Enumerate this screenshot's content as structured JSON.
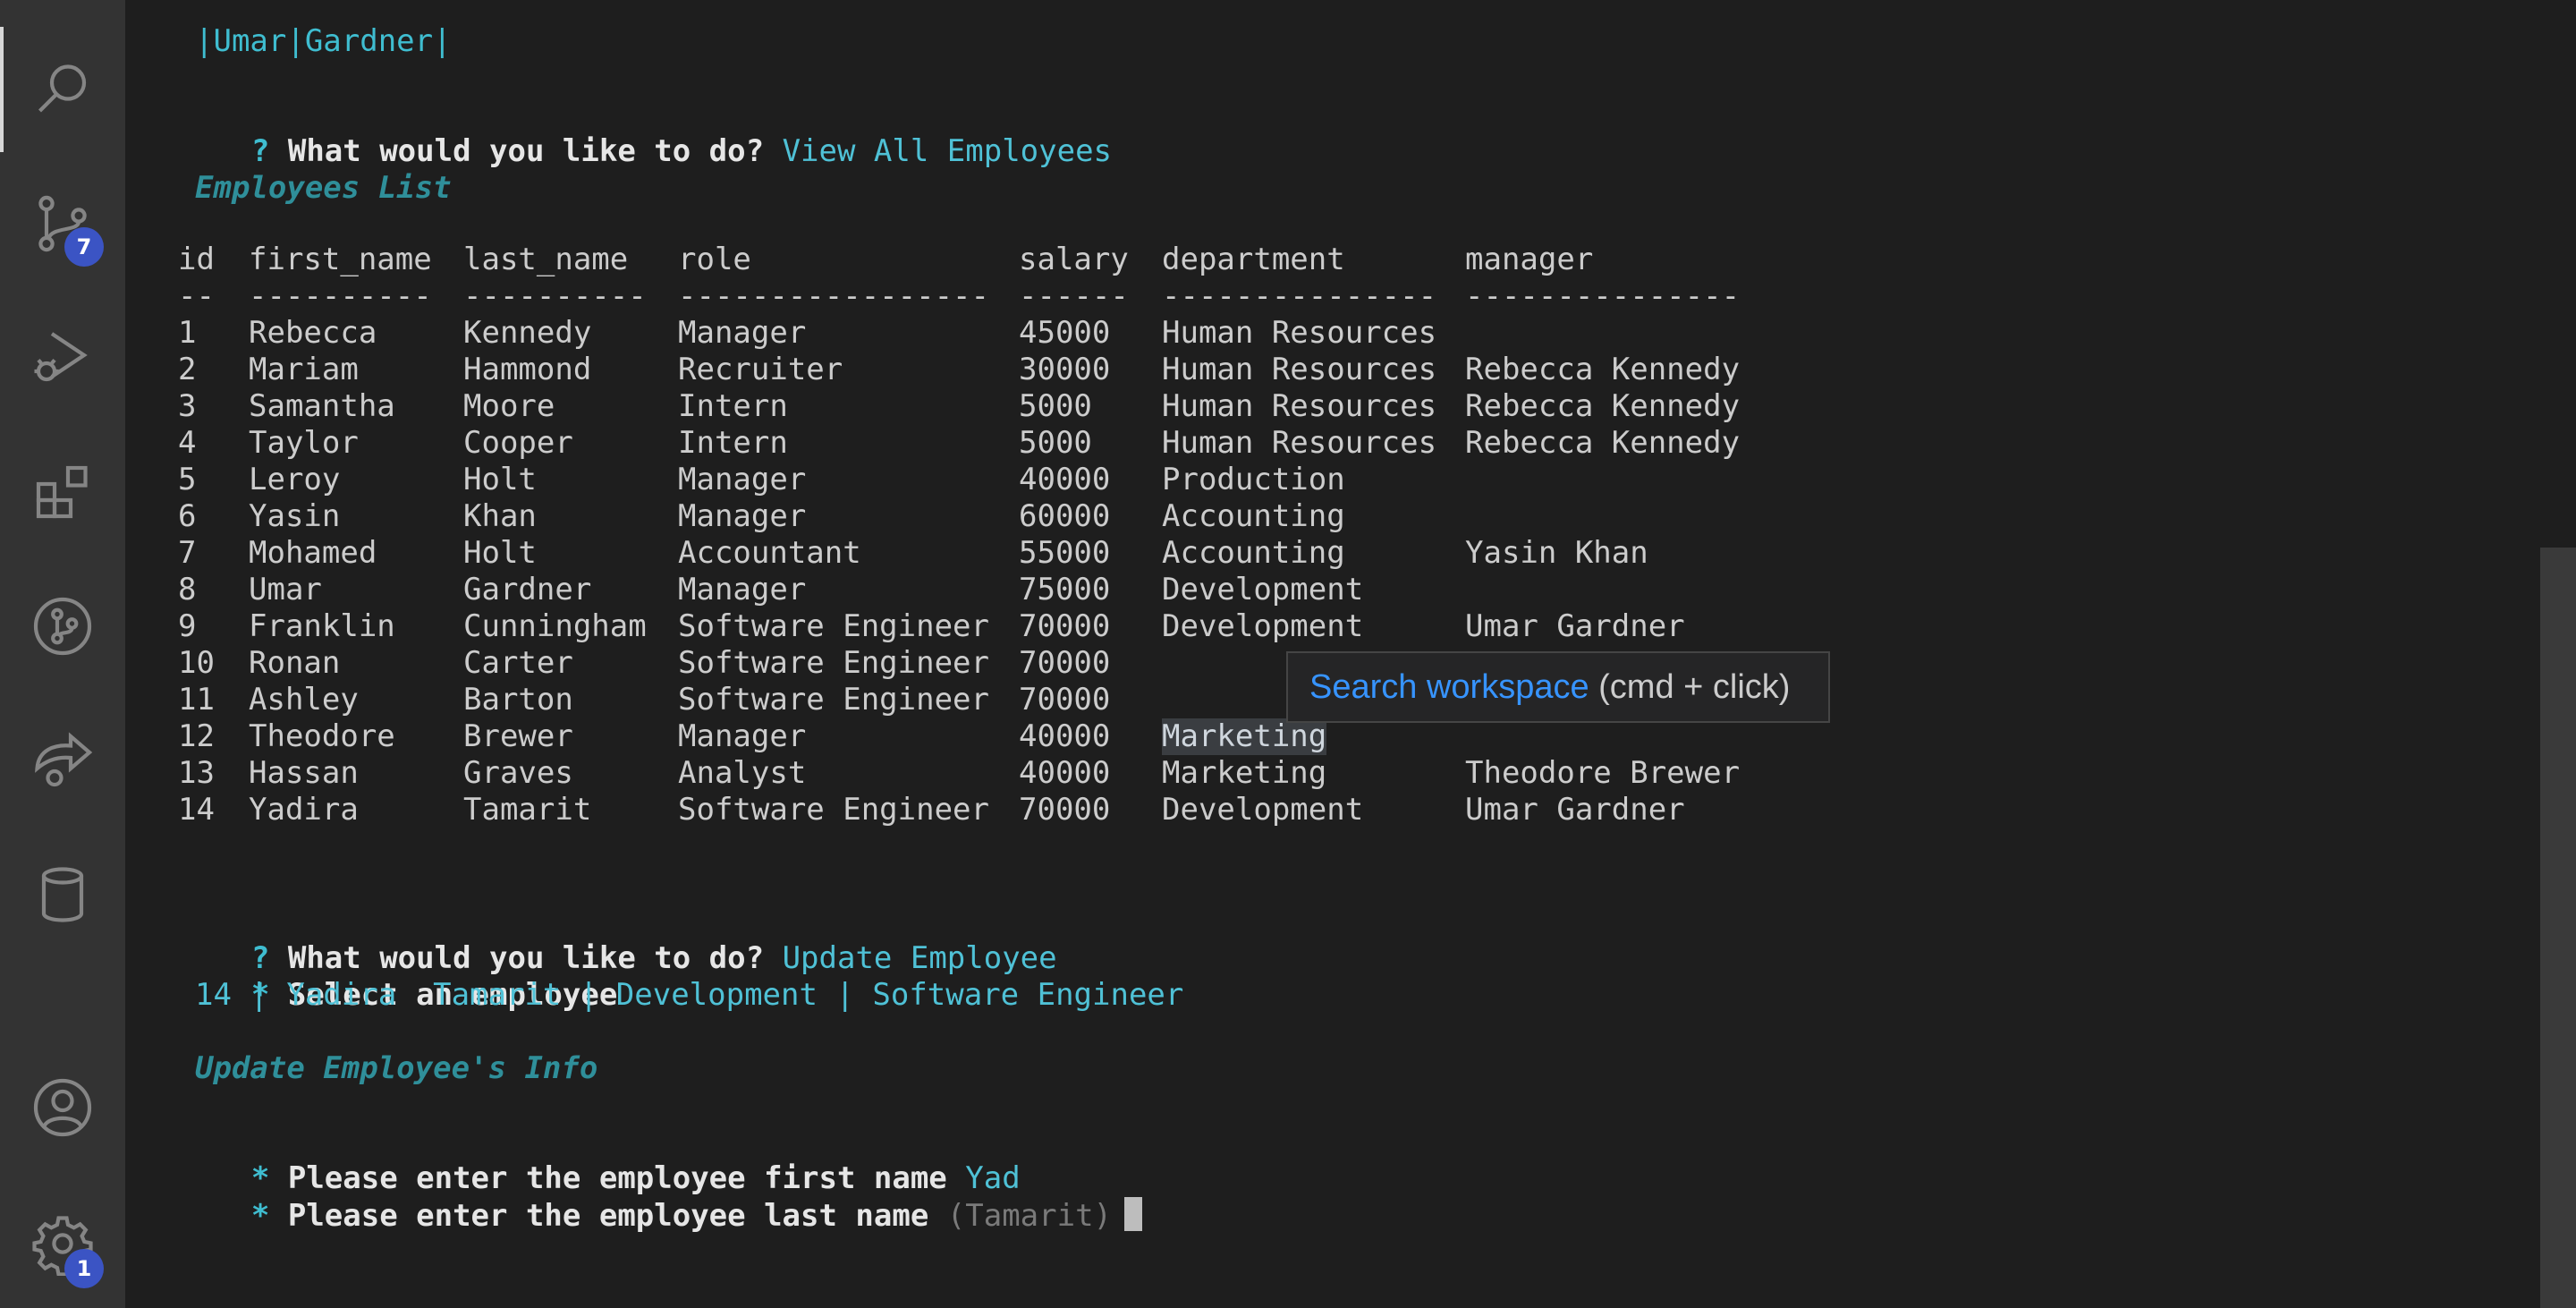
{
  "activity_bar": {
    "items": [
      {
        "name": "search-icon",
        "label": "Search"
      },
      {
        "name": "source-control-icon",
        "label": "Source Control",
        "badge": "7"
      },
      {
        "name": "run-debug-icon",
        "label": "Run and Debug"
      },
      {
        "name": "extensions-icon",
        "label": "Extensions"
      },
      {
        "name": "git-graph-icon",
        "label": "Git Graph"
      },
      {
        "name": "live-share-icon",
        "label": "Live Share"
      },
      {
        "name": "database-icon",
        "label": "Database"
      }
    ],
    "bottom": [
      {
        "name": "account-icon",
        "label": "Accounts"
      },
      {
        "name": "settings-gear-icon",
        "label": "Manage",
        "badge": "1"
      }
    ]
  },
  "terminal": {
    "top_line": "|Umar|Gardner|",
    "prompt_q": "?",
    "prompt_text": "What would you like to do?",
    "answer1": "View All Employees",
    "section1": "Employees List",
    "columns": [
      "id",
      "first_name",
      "last_name",
      "role",
      "salary",
      "department",
      "manager"
    ],
    "underlines": [
      "--",
      "----------",
      "----------",
      "-----------------",
      "------",
      "---------------",
      "---------------"
    ],
    "rows": [
      [
        "1",
        "Rebecca",
        "Kennedy",
        "Manager",
        "45000",
        "Human Resources",
        ""
      ],
      [
        "2",
        "Mariam",
        "Hammond",
        "Recruiter",
        "30000",
        "Human Resources",
        "Rebecca Kennedy"
      ],
      [
        "3",
        "Samantha",
        "Moore",
        "Intern",
        "5000",
        "Human Resources",
        "Rebecca Kennedy"
      ],
      [
        "4",
        "Taylor",
        "Cooper",
        "Intern",
        "5000",
        "Human Resources",
        "Rebecca Kennedy"
      ],
      [
        "5",
        "Leroy",
        "Holt",
        "Manager",
        "40000",
        "Production",
        ""
      ],
      [
        "6",
        "Yasin",
        "Khan",
        "Manager",
        "60000",
        "Accounting",
        ""
      ],
      [
        "7",
        "Mohamed",
        "Holt",
        "Accountant",
        "55000",
        "Accounting",
        "Yasin Khan"
      ],
      [
        "8",
        "Umar",
        "Gardner",
        "Manager",
        "75000",
        "Development",
        ""
      ],
      [
        "9",
        "Franklin",
        "Cunningham",
        "Software Engineer",
        "70000",
        "Development",
        "Umar Gardner"
      ],
      [
        "10",
        "Ronan",
        "Carter",
        "Software Engineer",
        "70000",
        "",
        ""
      ],
      [
        "11",
        "Ashley",
        "Barton",
        "Software Engineer",
        "70000",
        "",
        ""
      ],
      [
        "12",
        "Theodore",
        "Brewer",
        "Manager",
        "40000",
        "Marketing",
        ""
      ],
      [
        "13",
        "Hassan",
        "Graves",
        "Analyst",
        "40000",
        "Marketing",
        "Theodore Brewer"
      ],
      [
        "14",
        "Yadira",
        "Tamarit",
        "Software Engineer",
        "70000",
        "Development",
        "Umar Gardner"
      ]
    ],
    "answer2": "Update Employee",
    "star": "*",
    "select_label": "Select an employee",
    "selected_employee": "14 | Yadira  Tamarit | Development | Software Engineer",
    "section2": "Update Employee's Info",
    "first_name_label": "Please enter the employee first name",
    "first_name_value": "Yad",
    "last_name_label": "Please enter the employee last name",
    "last_name_default": "(Tamarit)"
  },
  "tooltip": {
    "link": "Search workspace",
    "hint": " (cmd + click)"
  }
}
